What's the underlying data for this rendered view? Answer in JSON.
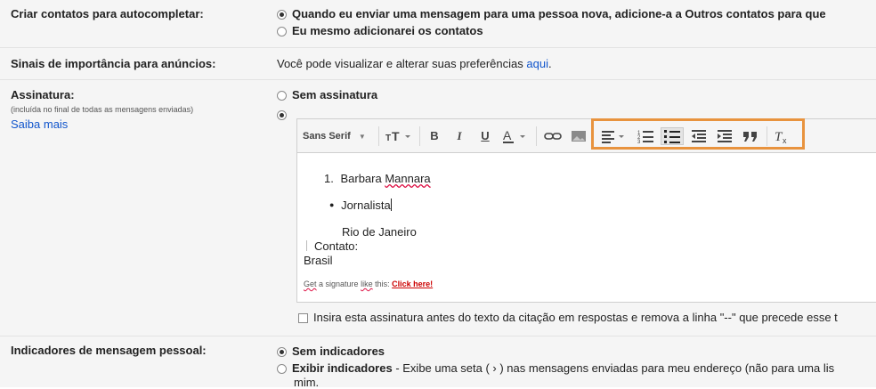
{
  "settings": {
    "autocomplete": {
      "label": "Criar contatos para autocompletar:",
      "option1": "Quando eu enviar uma mensagem para uma pessoa nova, adicione-a a Outros contatos para que",
      "option2": "Eu mesmo adicionarei os contatos"
    },
    "ads": {
      "label": "Sinais de importância para anúncios:",
      "text": "Você pode visualizar e alterar suas preferências",
      "link": "aqui",
      "period": "."
    },
    "signature": {
      "label": "Assinatura:",
      "sublabel": "(incluída no final de todas as mensagens enviadas)",
      "learn_more": "Saiba mais",
      "option_none": "Sem assinatura",
      "insert_before_label": "Insira esta assinatura antes do texto da citação em respostas e remova a linha \"--\" que precede esse t"
    },
    "indicators": {
      "label": "Indicadores de mensagem pessoal:",
      "option1": "Sem indicadores",
      "option2_bold": "Exibir indicadores",
      "option2_text": " - Exibe uma seta ( › ) nas mensagens enviadas para meu endereço (não para uma lis",
      "option2_cont": "mim."
    }
  },
  "editor": {
    "toolbar": {
      "font": "Sans Serif",
      "bold": "B",
      "italic": "I",
      "underline": "U",
      "text_color": "A"
    },
    "content": {
      "numbered_number": "1.",
      "name_first": "Barbara",
      "name_last": "Mannara",
      "bullet_item": "Jornalista",
      "city": "Rio de Janeiro",
      "contact": "Contato:",
      "country": "Brasil",
      "promo_prefix": "Get",
      "promo_a": "a signature",
      "promo_like": "like",
      "promo_this": "this:",
      "promo_link": "Click here!"
    }
  },
  "colors": {
    "link": "#1155cc",
    "highlight_border": "#e8933e",
    "promo_link": "#cc0000"
  }
}
